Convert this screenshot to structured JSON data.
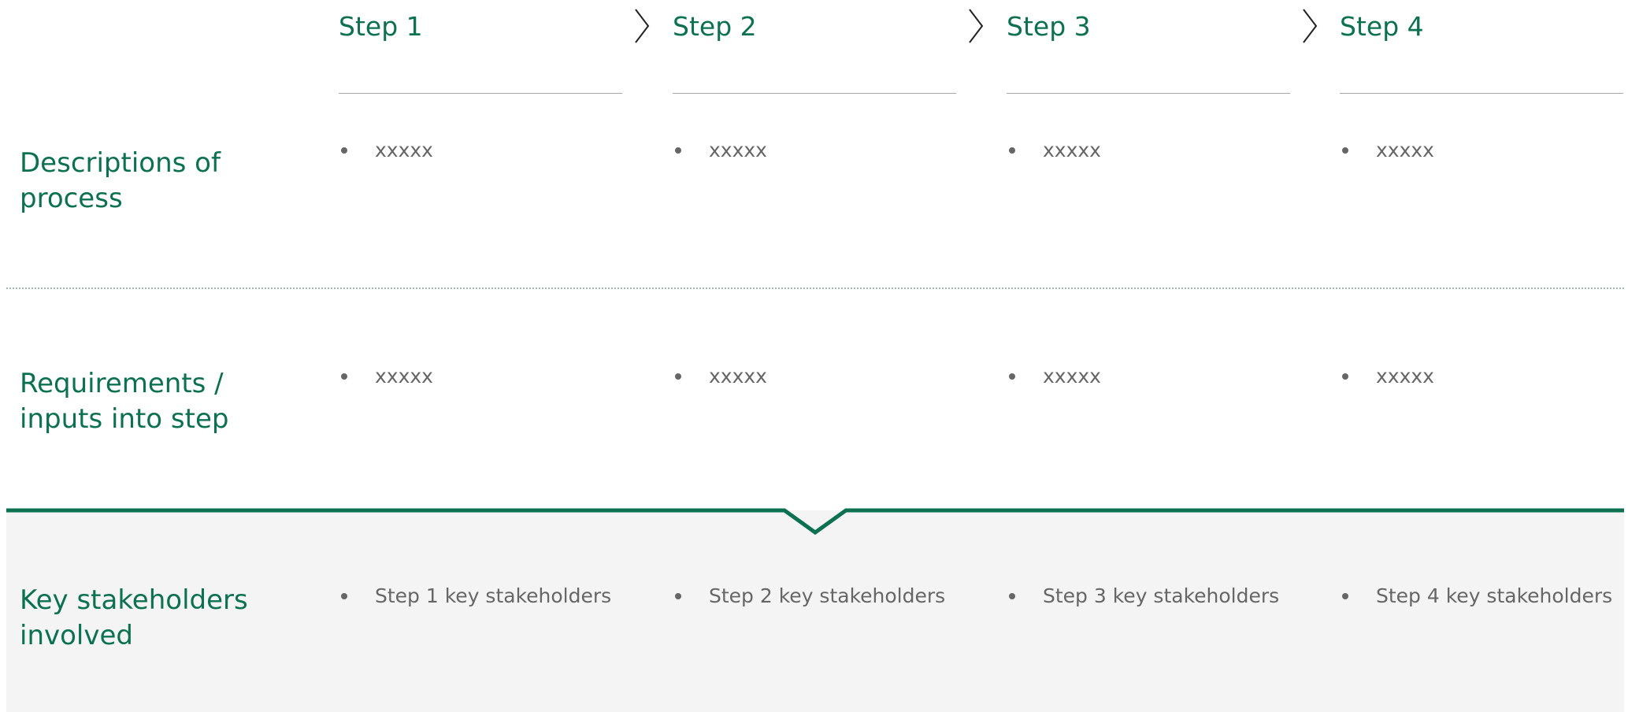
{
  "steps": [
    {
      "label": "Step 1"
    },
    {
      "label": "Step 2"
    },
    {
      "label": "Step 3"
    },
    {
      "label": "Step 4"
    }
  ],
  "rows": {
    "descriptions": {
      "label": "Descriptions of process",
      "cells": [
        "xxxxx",
        "xxxxx",
        "xxxxx",
        "xxxxx"
      ]
    },
    "requirements": {
      "label": "Requirements / inputs into step",
      "cells": [
        "xxxxx",
        "xxxxx",
        "xxxxx",
        "xxxxx"
      ]
    },
    "stakeholders": {
      "label": "Key stakeholders involved",
      "cells": [
        "Step 1 key stakeholders",
        "Step 2 key stakeholders",
        "Step 3 key stakeholders",
        "Step 4 key stakeholders"
      ]
    }
  },
  "colors": {
    "accent": "#0b7150",
    "body_text": "#666666",
    "panel_bg": "#f4f4f4",
    "divider": "#a6a6a6"
  },
  "icons": {
    "step_separator": "chevron-right-icon",
    "section_pointer": "chevron-down-icon"
  }
}
